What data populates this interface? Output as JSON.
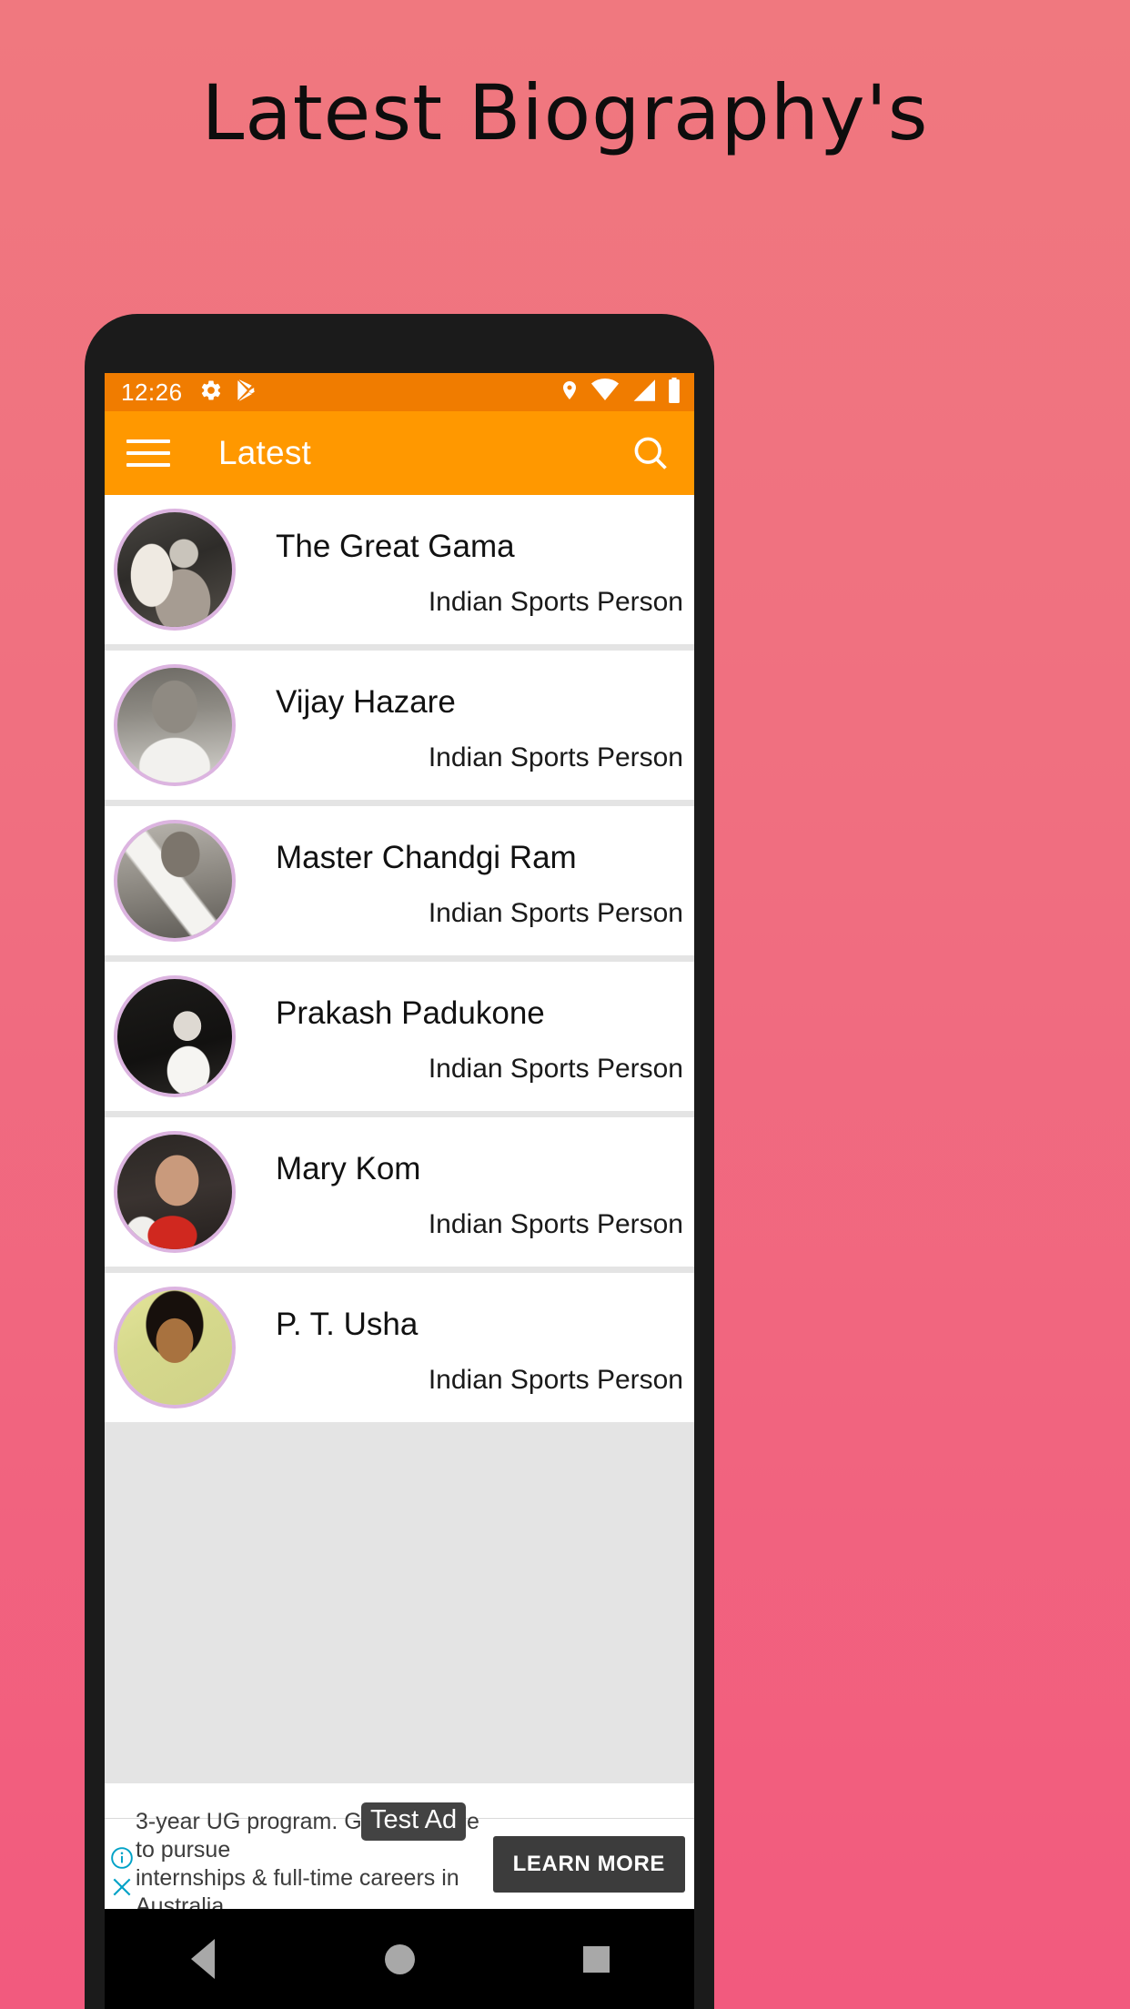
{
  "page": {
    "title": "Latest Biography's",
    "background_top": "#f0787f",
    "background_bottom": "#f25a7e"
  },
  "status_bar": {
    "time": "12:26",
    "background": "#f07c00",
    "left_icons": [
      "gear-icon",
      "play-store-icon"
    ],
    "right_icons": [
      "location-pin-icon",
      "wifi-icon",
      "signal-icon",
      "battery-icon"
    ]
  },
  "app_bar": {
    "title": "Latest",
    "background": "#ff9800",
    "menu_icon": "hamburger-menu-icon",
    "search_icon": "search-icon"
  },
  "list": {
    "avatar_border_color": "#dcb4e0",
    "items": [
      {
        "name": "The Great Gama",
        "subtitle": "Indian Sports Person",
        "avatar": "portrait-the-great-gama"
      },
      {
        "name": "Vijay Hazare",
        "subtitle": "Indian Sports Person",
        "avatar": "portrait-vijay-hazare"
      },
      {
        "name": "Master Chandgi Ram",
        "subtitle": "Indian Sports Person",
        "avatar": "portrait-master-chandgi-ram"
      },
      {
        "name": "Prakash Padukone",
        "subtitle": "Indian Sports Person",
        "avatar": "portrait-prakash-padukone"
      },
      {
        "name": "Mary Kom",
        "subtitle": "Indian Sports Person",
        "avatar": "portrait-mary-kom"
      },
      {
        "name": "P. T. Usha",
        "subtitle": "Indian Sports Person",
        "avatar": "portrait-pt-usha"
      }
    ]
  },
  "ad": {
    "badge": "Test Ad",
    "line1": "3-year UG program. Get a chance to pursue",
    "line2": "internships & full-time careers in Australia.",
    "cta": "LEARN MORE",
    "info_icon": "info-icon",
    "close_icon": "close-icon",
    "icon_color": "#00a2c7"
  },
  "nav_bar": {
    "back": "back-triangle-icon",
    "home": "home-circle-icon",
    "recents": "recents-square-icon"
  }
}
